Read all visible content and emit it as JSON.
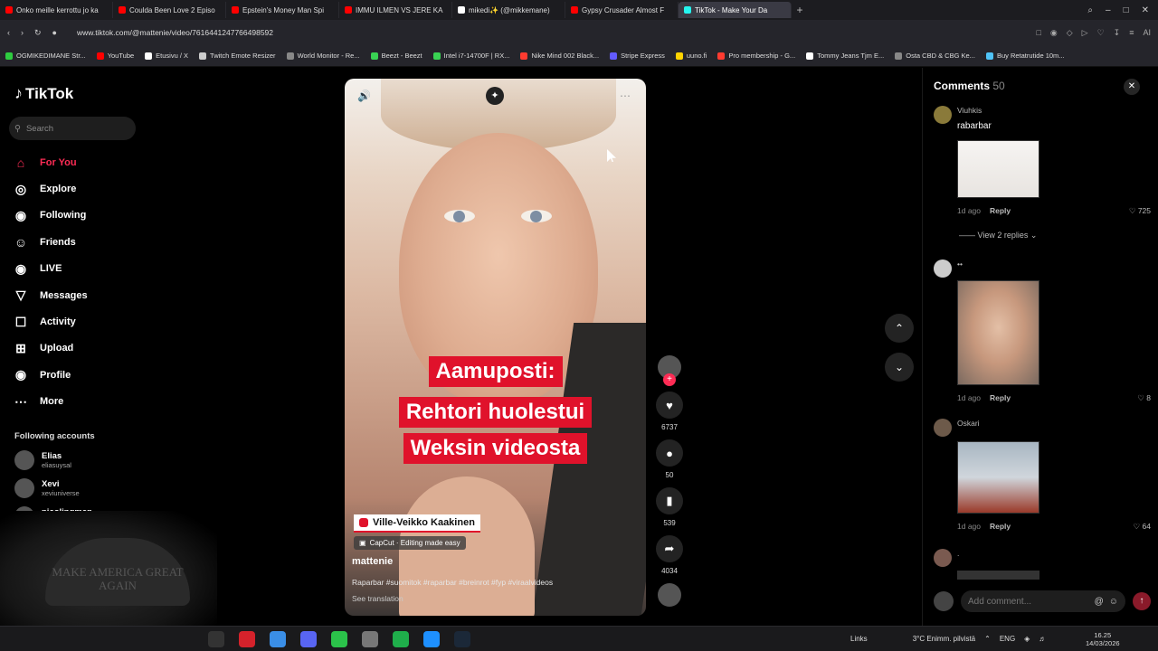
{
  "browser": {
    "tabs": [
      {
        "label": "Onko meille kerrottu jo ka",
        "color": "#ff0000"
      },
      {
        "label": "Coulda Been Love 2 Episo",
        "color": "#ff0000"
      },
      {
        "label": "Epstein's Money Man Spi",
        "color": "#ff0000"
      },
      {
        "label": "IMMU ILMEN VS JERE KA",
        "color": "#ff0000"
      },
      {
        "label": "mikedi✨ (@mikkemane)",
        "color": "#ffffff"
      },
      {
        "label": "Gypsy Crusader Almost F",
        "color": "#ff0000"
      },
      {
        "label": "TikTok - Make Your Da",
        "color": "#25f4ee"
      }
    ],
    "url": "www.tiktok.com/@mattenie/video/7616441247766498592",
    "bookmarks": [
      {
        "label": "OGMIKEDIMANE Str...",
        "color": "#2ecc40"
      },
      {
        "label": "YouTube",
        "color": "#ff0000"
      },
      {
        "label": "Etusivu / X",
        "color": "#ffffff"
      },
      {
        "label": "Twitch Emote Resizer",
        "color": "#cccccc"
      },
      {
        "label": "World Monitor - Re...",
        "color": "#888888"
      },
      {
        "label": "Beezt - Beezt",
        "color": "#39d353"
      },
      {
        "label": "Intel i7-14700F | RX...",
        "color": "#39d353"
      },
      {
        "label": "Nike Mind 002 Black...",
        "color": "#ff3b30"
      },
      {
        "label": "Stripe Express",
        "color": "#635bff"
      },
      {
        "label": "uuno.fi",
        "color": "#ffd400"
      },
      {
        "label": "Pro membership - G...",
        "color": "#ff3b30"
      },
      {
        "label": "Tommy Jeans Tjm E...",
        "color": "#ffffff"
      },
      {
        "label": "Osta CBD & CBG Ke...",
        "color": "#888888"
      },
      {
        "label": "Buy Retatrutide 10m...",
        "color": "#4fc3f7"
      }
    ]
  },
  "sidebar": {
    "logo": "TikTok",
    "search_placeholder": "Search",
    "nav": [
      {
        "label": "For You",
        "icon": "home-icon",
        "glyph": "⌂"
      },
      {
        "label": "Explore",
        "icon": "compass-icon",
        "glyph": "◎"
      },
      {
        "label": "Following",
        "icon": "following-icon",
        "glyph": "◉"
      },
      {
        "label": "Friends",
        "icon": "friends-icon",
        "glyph": "☺"
      },
      {
        "label": "LIVE",
        "icon": "live-icon",
        "glyph": "◉"
      },
      {
        "label": "Messages",
        "icon": "messages-icon",
        "glyph": "▽"
      },
      {
        "label": "Activity",
        "icon": "activity-icon",
        "glyph": "☐"
      },
      {
        "label": "Upload",
        "icon": "upload-icon",
        "glyph": "⊞"
      },
      {
        "label": "Profile",
        "icon": "profile-icon",
        "glyph": "◉"
      },
      {
        "label": "More",
        "icon": "more-icon",
        "glyph": "⋯"
      }
    ],
    "following_title": "Following accounts",
    "following": [
      {
        "name": "Elias",
        "handle": "eliasuysal"
      },
      {
        "name": "Xevi",
        "handle": "xeviuniverse"
      },
      {
        "name": "nicolingman",
        "handle": "nicolingman"
      }
    ],
    "webcam_cap_text": "MAKE AMERICA GREAT AGAIN"
  },
  "video": {
    "headline": [
      "Aamuposti:",
      "Rehtori huolestui",
      "Weksin videosta"
    ],
    "name_tag": "Ville-Veikko Kaakinen",
    "capcut": "CapCut · Editing made easy",
    "username": "mattenie",
    "description": "Raparbar #suomitok #raparbar #breinrot #fyp #viraalvideos",
    "see_translation": "See translation",
    "actions": {
      "likes": "6737",
      "comments": "50",
      "saves": "539",
      "shares": "4034"
    }
  },
  "comments": {
    "title": "Comments",
    "count": "50",
    "items": [
      {
        "user": "Viuhkis",
        "text": "rabarbar",
        "time": "1d ago",
        "reply": "Reply",
        "likes": "725"
      },
      {
        "user": "••",
        "text": "",
        "time": "1d ago",
        "reply": "Reply",
        "likes": "8"
      },
      {
        "user": "Oskari",
        "text": "",
        "time": "1d ago",
        "reply": "Reply",
        "likes": "64"
      }
    ],
    "view_replies": "View 2 replies",
    "fourth_user": ".",
    "input_placeholder": "Add comment..."
  },
  "taskbar": {
    "links": "Links",
    "weather": "3°C  Enimm. pilvistä",
    "lang": "ENG",
    "time": "16.25",
    "date": "14/03/2026"
  }
}
